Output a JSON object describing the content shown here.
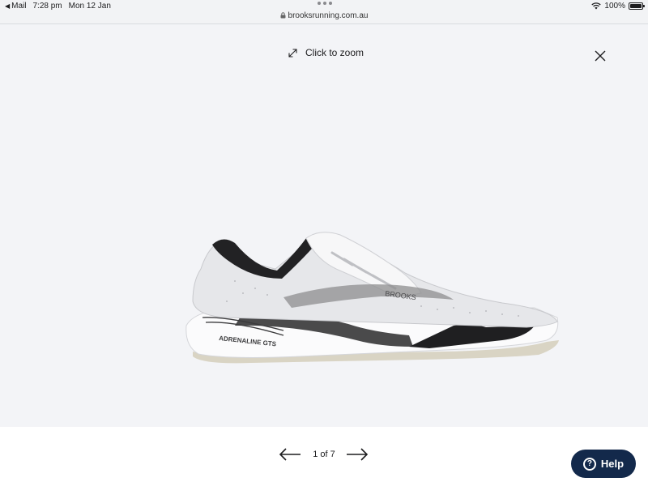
{
  "status_bar": {
    "back_label": "Mail",
    "time": "7:28 pm",
    "date": "Mon 12 Jan",
    "battery": "100%",
    "url": "brooksrunning.com.au"
  },
  "viewer": {
    "zoom_hint": "Click to zoom",
    "product_model_text": "ADRENALINE GTS",
    "brand_text": "BROOKS"
  },
  "pager": {
    "counter": "1 of 7"
  },
  "help": {
    "label": "Help"
  },
  "colors": {
    "help_button": "#13294b",
    "viewer_bg": "#f3f4f7"
  }
}
